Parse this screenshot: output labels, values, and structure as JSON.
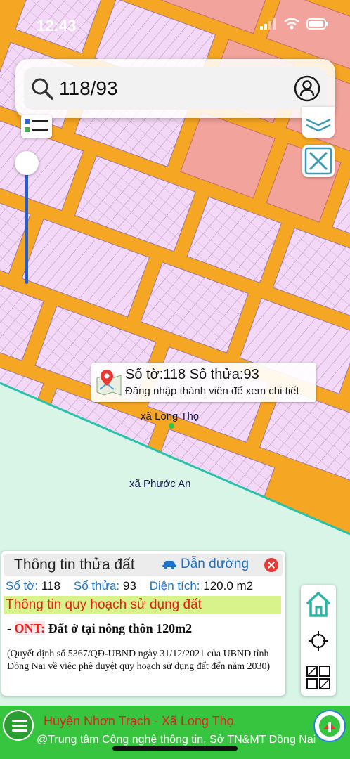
{
  "status": {
    "time": "12:43"
  },
  "search": {
    "value": "118/93"
  },
  "popup": {
    "title": "Số tờ:118 Số thửa:93",
    "subtitle": "Đăng nhập thành viên để xem chi tiết"
  },
  "map_labels": {
    "commune_long_tho": "xã Long Thọ",
    "commune_phuoc_an": "xã Phước An"
  },
  "info": {
    "title": "Thông tin thửa đất",
    "directions_label": "Dẫn đường",
    "sheet_label": "Số tờ:",
    "sheet_value": "118",
    "parcel_label": "Số thửa:",
    "parcel_value": "93",
    "area_label": "Diện tích:",
    "area_value": "120.0 m2",
    "plan_heading": "Thông tin quy hoạch sử dụng đất",
    "zone_prefix": "- ",
    "zone_code": "ONT:",
    "zone_desc": " Đất ở tại nông thôn 120m2",
    "decision_text": "(Quyết định số 5367/QĐ-UBND ngày 31/12/2021 của UBND tỉnh Đồng Nai về việc phê duyệt quy hoạch sử dụng đất đến năm 2030)"
  },
  "footer": {
    "district": "Huyện Nhơn Trạch - Xã Long Thọ",
    "credit": "@Trung tâm Công nghệ thông tin, Sở TN&MT Đồng Nai"
  },
  "colors": {
    "road": "#f5a623",
    "parcel": "#f3d9f7",
    "residential_block": "#f2a49c",
    "outside": "#d9f5e8",
    "accent_blue": "#1e73c9",
    "plan_heading_bg": "#d8f28c",
    "footer_bg": "#37c43f"
  }
}
